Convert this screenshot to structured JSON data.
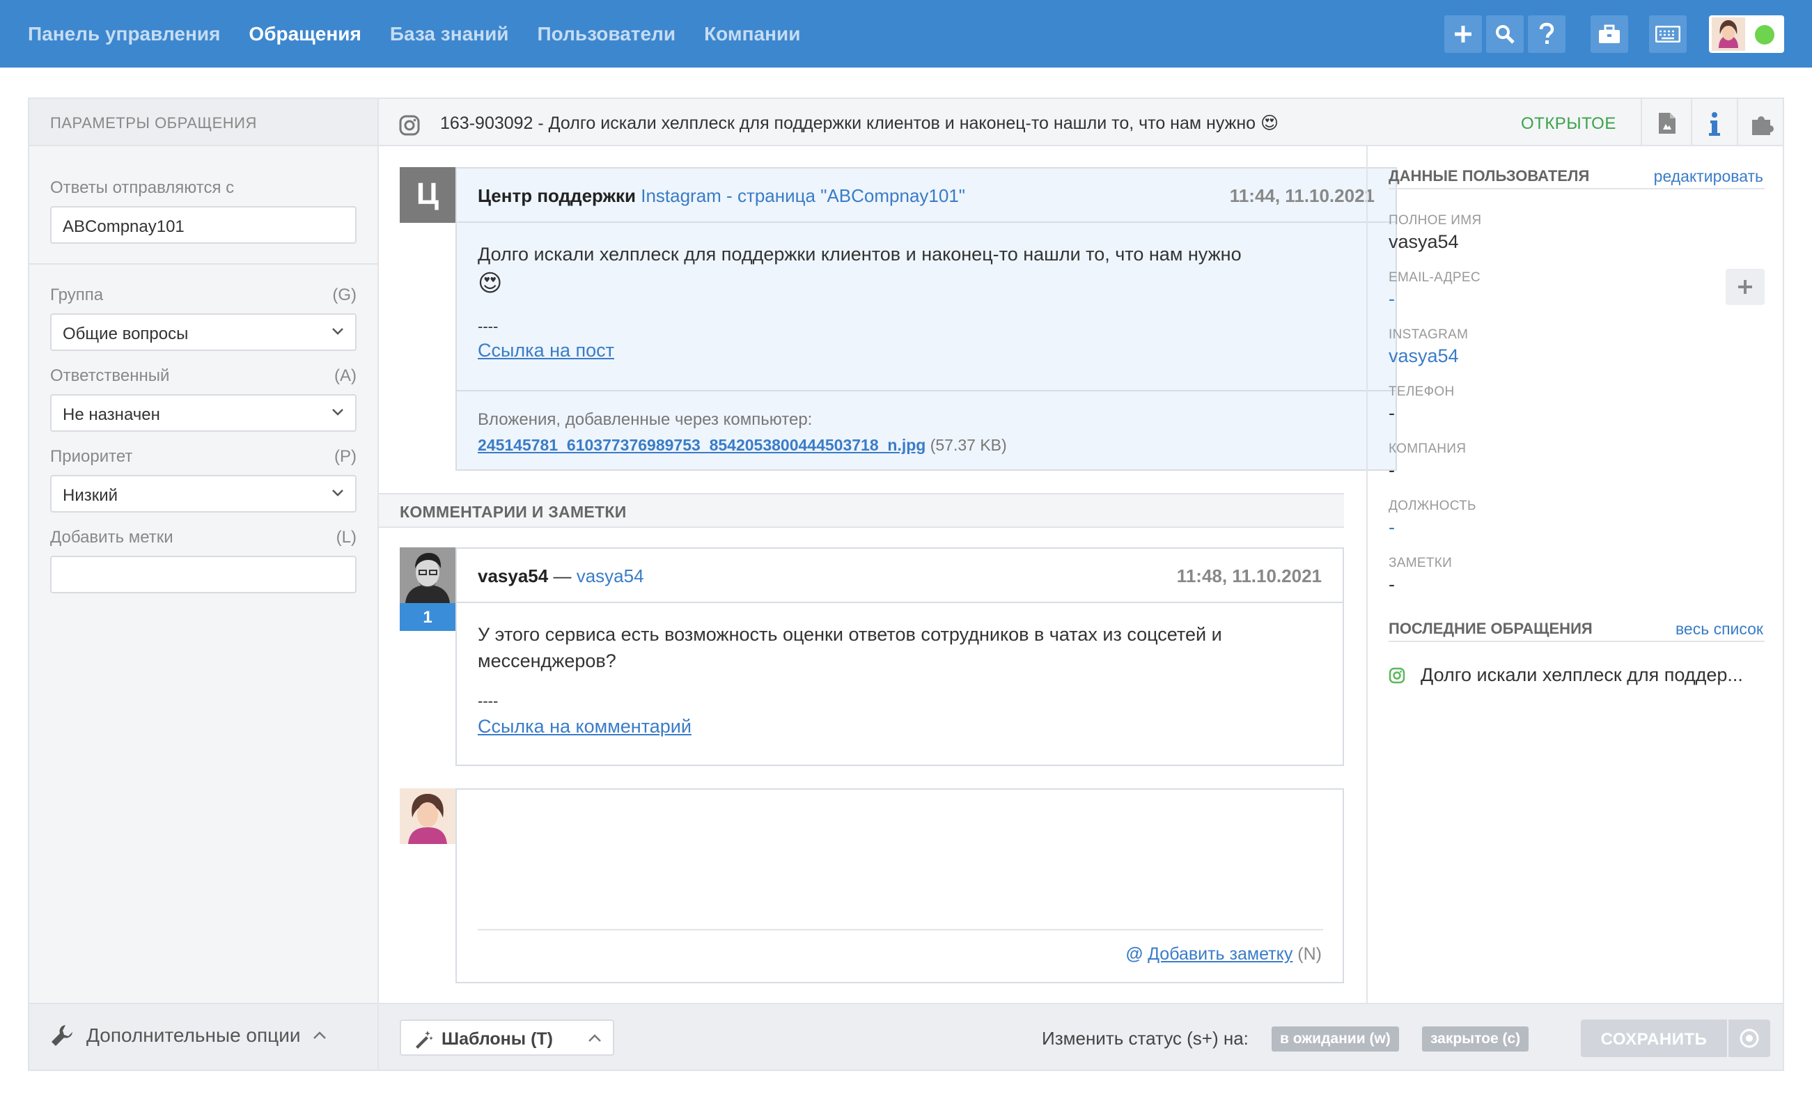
{
  "nav": {
    "items": [
      "Панель управления",
      "Обращения",
      "База знаний",
      "Пользователи",
      "Компании"
    ],
    "active_index": 1,
    "icons": [
      "plus-icon",
      "search-icon",
      "help-icon",
      "briefcase-icon",
      "keyboard-icon"
    ]
  },
  "colors": {
    "nav_bg": "#3d87cf",
    "nav_button": "#5a9ad9",
    "link": "#3a7cc7",
    "status_open": "#3aa34a",
    "online": "#6ed34d",
    "badge": "#3a8ed9"
  },
  "left": {
    "header": "ПАРАМЕТРЫ ОБРАЩЕНИЯ",
    "from_label": "Ответы отправляются с",
    "from_value": "ABCompnay101",
    "group_label": "Группа",
    "group_key": "(G)",
    "group_value": "Общие вопросы",
    "assignee_label": "Ответственный",
    "assignee_key": "(A)",
    "assignee_value": "Не назначен",
    "priority_label": "Приоритет",
    "priority_key": "(P)",
    "priority_value": "Низкий",
    "tags_label": "Добавить метки",
    "tags_key": "(L)",
    "tags_value": ""
  },
  "ticket": {
    "channel_icon": "instagram-icon",
    "title": "163-903092 - Долго искали хелплеск для поддержки клиентов и наконец-то нашли то, что нам нужно 😍",
    "status": "ОТКРЫТОЕ",
    "toolbar_icons": [
      "pdf-icon",
      "info-icon",
      "puzzle-icon"
    ]
  },
  "message1": {
    "avatar_letter": "Ц",
    "author": "Центр поддержки",
    "source": "Instagram - страница \"ABCompnay101\"",
    "time": "11:44, 11.10.2021",
    "line1": "Долго искали хелплеск для поддержки клиентов и наконец-то нашли то, что нам нужно",
    "emoji": "😍",
    "separator": "----",
    "link": "Ссылка на пост",
    "attach_label": "Вложения, добавленные через компьютер:",
    "attach_file": "245145781_610377376989753_8542053800444503718_n.jpg",
    "attach_size": "(57.37 KB)"
  },
  "comments_header": "КОММЕНТАРИИ И ЗАМЕТКИ",
  "message2": {
    "author": "vasya54",
    "dash": "—",
    "source": "vasya54",
    "time": "11:48, 11.10.2021",
    "badge": "1",
    "line1": "У этого сервиса есть возможность оценки ответов сотрудников в чатах из соцсетей и",
    "line2": "мессенджеров?",
    "separator": "----",
    "link": "Ссылка на комментарий"
  },
  "reply": {
    "at": "@",
    "add_note": "Добавить заметку",
    "add_note_key": "(N)"
  },
  "user_panel": {
    "header": "ДАННЫЕ ПОЛЬЗОВАТЕЛЯ",
    "edit": "редактировать",
    "full_name_label": "ПОЛНОЕ ИМЯ",
    "full_name": "vasya54",
    "email_label": "EMAIL-АДРЕС",
    "email": "-",
    "instagram_label": "INSTAGRAM",
    "instagram": "vasya54",
    "phone_label": "ТЕЛЕФОН",
    "phone": "-",
    "company_label": "КОМПАНИЯ",
    "company": "-",
    "position_label": "ДОЛЖНОСТЬ",
    "position": "-",
    "notes_label": "ЗАМЕТКИ",
    "notes": "-",
    "recent_header": "ПОСЛЕДНИЕ ОБРАЩЕНИЯ",
    "recent_all": "весь список",
    "recent_item": "Долго искали хелплеск для поддер..."
  },
  "footer": {
    "options": "Дополнительные опции",
    "templates": "Шаблоны (T)",
    "change_status": "Изменить статус (s+) на:",
    "pending": "в ожидании (w)",
    "closed": "закрытое (c)",
    "save": "СОХРАНИТЬ"
  }
}
